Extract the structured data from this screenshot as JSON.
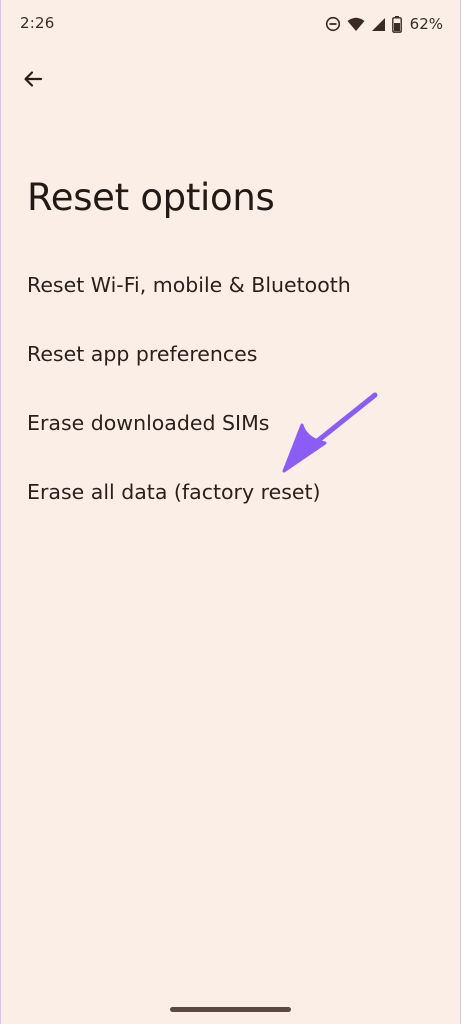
{
  "status_bar": {
    "time": "2:26",
    "battery": "62%",
    "icons": [
      "do-not-disturb-icon",
      "wifi-icon",
      "cellular-signal-icon",
      "battery-icon"
    ]
  },
  "header": {
    "back_icon": "arrow-left-icon",
    "title": "Reset options"
  },
  "options": [
    {
      "label": "Reset Wi-Fi, mobile & Bluetooth"
    },
    {
      "label": "Reset app preferences"
    },
    {
      "label": "Erase downloaded SIMs"
    },
    {
      "label": "Erase all data (factory reset)"
    }
  ],
  "annotation": {
    "icon": "pointer-arrow-icon",
    "color": "#8b5cf6"
  },
  "colors": {
    "background": "#faeee6",
    "text": "#2b1f1a"
  }
}
